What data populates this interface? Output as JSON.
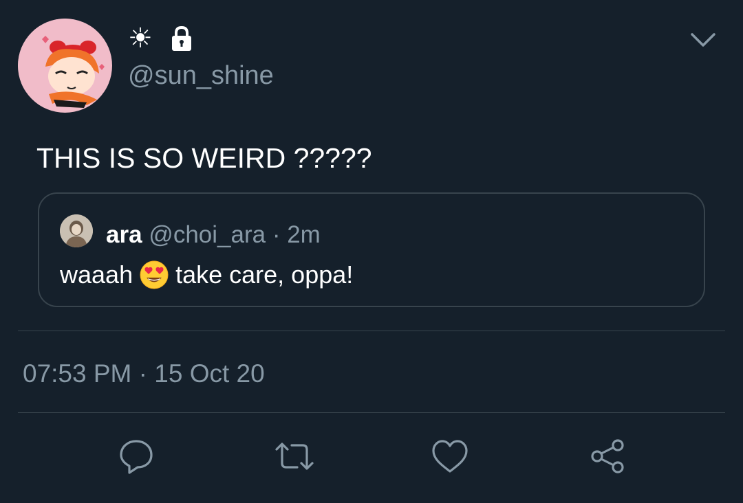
{
  "author": {
    "display_name": "☀",
    "handle": "@sun_shine",
    "locked": true,
    "avatar": "powerpuff-blossom-avatar"
  },
  "tweet": {
    "text": "THIS IS SO WEIRD ?????"
  },
  "quoted_tweet": {
    "name": "ara",
    "handle": "@choi_ara",
    "separator": " · ",
    "time": "2m",
    "text_before": "waaah",
    "emoji": "heart-eyes-emoji",
    "text_after": "take care, oppa!"
  },
  "meta": {
    "time": "07:53 PM",
    "separator": " · ",
    "date": "15 Oct 20"
  },
  "actions": [
    "reply-icon",
    "retweet-icon",
    "like-icon",
    "share-icon"
  ],
  "colors": {
    "background": "#15202b",
    "text_primary": "#ffffff",
    "text_secondary": "#8899a6",
    "border": "#38444d"
  }
}
